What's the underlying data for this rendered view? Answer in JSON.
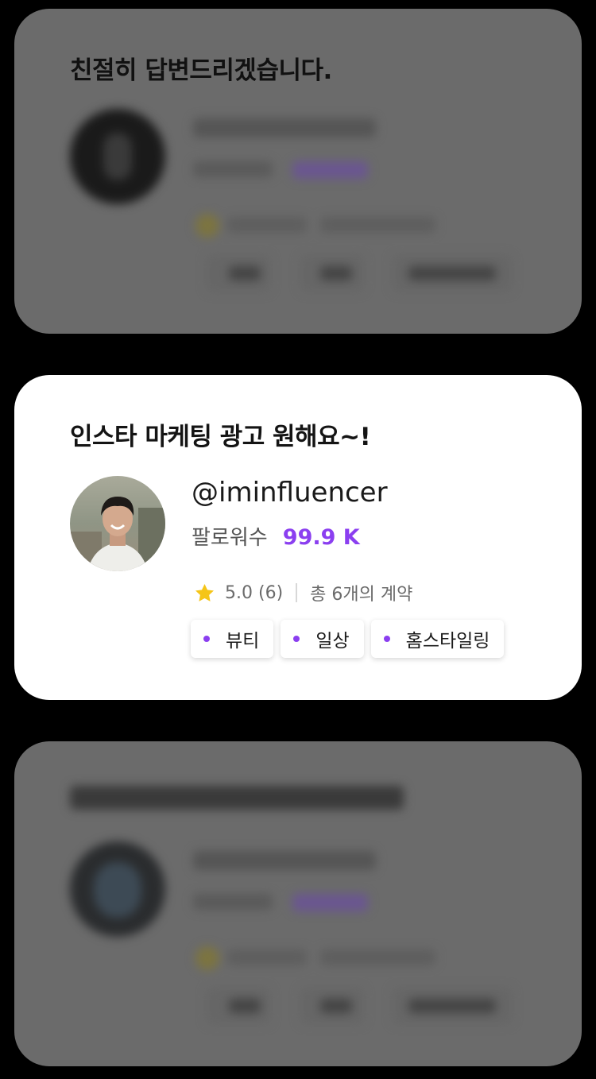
{
  "cards": [
    {
      "title": "친절히 답변드리겠습니다.",
      "state": "dimmed"
    },
    {
      "title": "인스타 마케팅 광고 원해요~!",
      "state": "active",
      "handle": "@iminfluencer",
      "followers_label": "팔로워수",
      "followers_value": "99.9 K",
      "rating": "5.0",
      "review_count": "(6)",
      "contracts": "총 6개의 계약",
      "tags": [
        "뷰티",
        "일상",
        "홈스타일링"
      ]
    },
    {
      "title": "",
      "state": "dimmed"
    }
  ],
  "colors": {
    "accent": "#8b3ff0",
    "star": "#f5c518",
    "overlay_card": "#6b6b6b",
    "background": "#000000"
  },
  "icons": {
    "rating": "star-icon",
    "tag_bullet": "dot-icon"
  }
}
